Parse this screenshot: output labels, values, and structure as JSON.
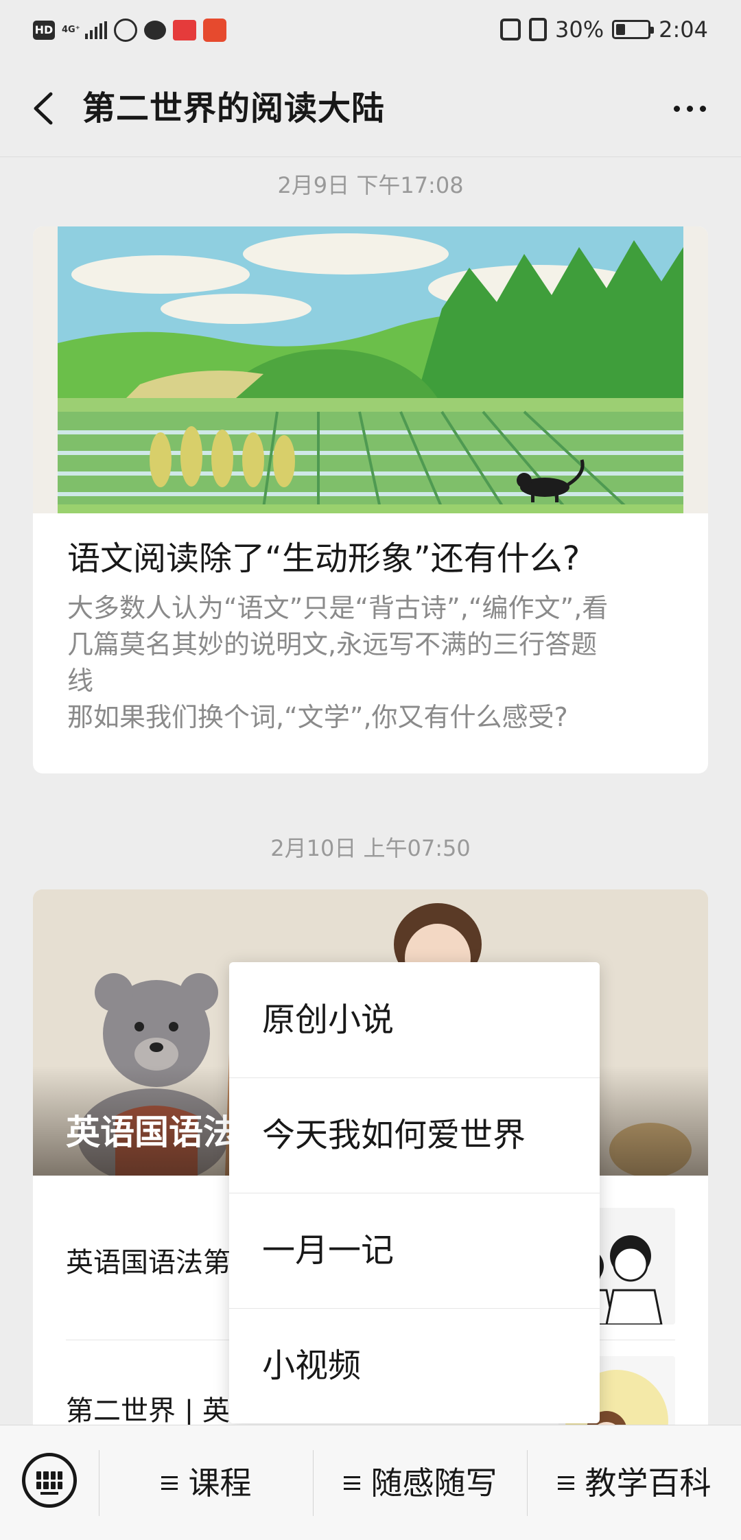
{
  "status_bar": {
    "network_badge": "HD",
    "network_type": "4G⁺",
    "battery_percent": "30%",
    "battery_level": 0.3,
    "time": "2:04"
  },
  "header": {
    "title": "第二世界的阅读大陆"
  },
  "feed": [
    {
      "timestamp": "2月9日 下午17:08",
      "title": "语文阅读除了“生动形象”还有什么?",
      "digest_lines": [
        "大多数人认为“语文”只是“背古诗”,“编作文”,看",
        "几篇莫名其妙的说明文,永远写不满的三行答题",
        "线",
        "那如果我们换个词,“文学”,你又有什么感受?"
      ]
    },
    {
      "timestamp": "2月10日 上午07:50",
      "cover_title": "英语国语法",
      "sub_items": [
        {
          "title": "英语国语法第"
        },
        {
          "title": "第二世界 | 英"
        }
      ]
    }
  ],
  "popup_menu": {
    "items": [
      "原创小说",
      "今天我如何爱世界",
      "一月一记",
      "小视频"
    ]
  },
  "bottom_bar": {
    "tabs": [
      "课程",
      "随感随写",
      "教学百科"
    ]
  },
  "colors": {
    "background": "#ededed",
    "card": "#ffffff",
    "timestamp": "#999999",
    "digest": "#8a8a8a"
  }
}
